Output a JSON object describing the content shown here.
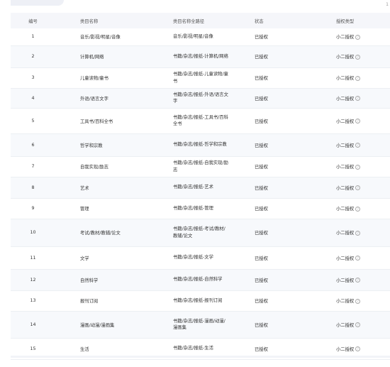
{
  "table": {
    "headers": {
      "id": "编号",
      "category_name": "类目名称",
      "full_path": "类目名称全路径",
      "status": "状态",
      "auth_type": "授权类型"
    },
    "rows": [
      {
        "id": "1",
        "name": "音乐/影视/明星/音像",
        "path": "音乐/影视/明星/音像",
        "status": "已授权",
        "auth": "小二授权"
      },
      {
        "id": "2",
        "name": "计算机/网络",
        "path": "书籍/杂志/报纸-计算机/网络",
        "status": "已授权",
        "auth": "小二授权"
      },
      {
        "id": "3",
        "name": "儿童读物/童书",
        "path": "书籍/杂志/报纸-儿童读物/童书",
        "status": "已授权",
        "auth": "小二授权"
      },
      {
        "id": "4",
        "name": "外语/语言文字",
        "path": "书籍/杂志/报纸-外语/语言文字",
        "status": "已授权",
        "auth": "小二授权"
      },
      {
        "id": "5",
        "name": "工具书/百科全书",
        "path": "书籍/杂志/报纸-工具书/百科全书",
        "status": "已授权",
        "auth": "小二授权"
      },
      {
        "id": "6",
        "name": "哲学和宗教",
        "path": "书籍/杂志/报纸-哲学和宗教",
        "status": "已授权",
        "auth": "小二授权"
      },
      {
        "id": "7",
        "name": "自我实现/励志",
        "path": "书籍/杂志/报纸-自我实现/励志",
        "status": "已授权",
        "auth": "小二授权"
      },
      {
        "id": "8",
        "name": "艺术",
        "path": "书籍/杂志/报纸-艺术",
        "status": "已授权",
        "auth": "小二授权"
      },
      {
        "id": "9",
        "name": "管理",
        "path": "书籍/杂志/报纸-管理",
        "status": "已授权",
        "auth": "小二授权"
      },
      {
        "id": "10",
        "name": "考试/教材/教辅/论文",
        "path": "书籍/杂志/报纸-考试/教材/教辅/论文",
        "status": "已授权",
        "auth": "小二授权"
      },
      {
        "id": "11",
        "name": "文学",
        "path": "书籍/杂志/报纸-文学",
        "status": "已授权",
        "auth": "小二授权"
      },
      {
        "id": "12",
        "name": "自然科学",
        "path": "书籍/杂志/报纸-自然科学",
        "status": "已授权",
        "auth": "小二授权"
      },
      {
        "id": "13",
        "name": "报刊订阅",
        "path": "书籍/杂志/报纸-报刊订阅",
        "status": "已授权",
        "auth": "小二授权"
      },
      {
        "id": "14",
        "name": "漫画/动漫/漫画集",
        "path": "书籍/杂志/报纸-漫画/动漫/漫画集",
        "status": "已授权",
        "auth": "小二授权"
      },
      {
        "id": "15",
        "name": "生活",
        "path": "书籍/杂志/报纸-生活",
        "status": "已授权",
        "auth": "小二授权"
      }
    ],
    "help_icon": "question-circle-icon"
  },
  "colors": {
    "header_bg": "#f5f6fa",
    "stripe_bg": "#f7f9fc",
    "text": "#333333"
  }
}
